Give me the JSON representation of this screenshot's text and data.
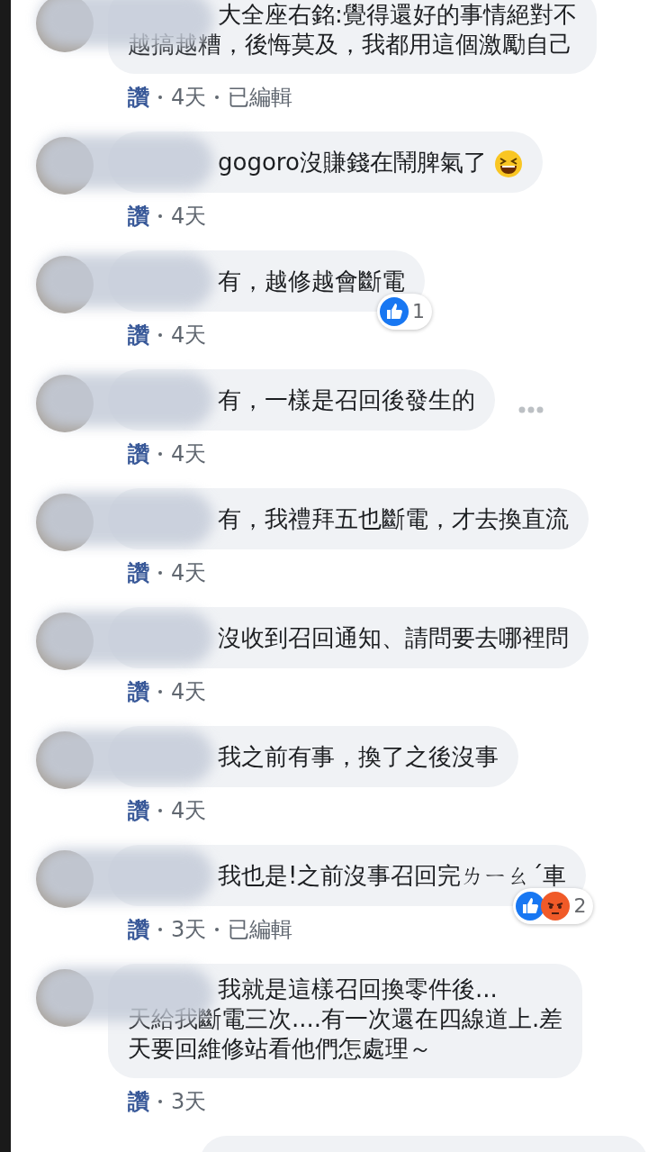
{
  "comments": [
    {
      "lines": [
        "大全座右銘:覺得還好的事情絕對不",
        "越搞越糟，後悔莫及，我都用這個激勵自己"
      ],
      "meta": {
        "like": "讚",
        "time": "4天",
        "edited": "已編輯"
      }
    },
    {
      "lines": [
        "gogoro沒賺錢在鬧脾氣了"
      ],
      "emoji": {
        "kind": "laughing"
      },
      "meta": {
        "like": "讚",
        "time": "4天"
      }
    },
    {
      "lines": [
        "有，越修越會斷電"
      ],
      "reactions": {
        "icons": [
          {
            "kind": "like"
          }
        ],
        "count": "1"
      },
      "meta": {
        "like": "讚",
        "time": "4天"
      }
    },
    {
      "lines": [
        "有，一樣是召回後發生的"
      ],
      "more_button": true,
      "meta": {
        "like": "讚",
        "time": "4天"
      }
    },
    {
      "lines": [
        "有，我禮拜五也斷電，才去換直流"
      ],
      "meta": {
        "like": "讚",
        "time": "4天"
      }
    },
    {
      "lines": [
        "沒收到召回通知、請問要去哪裡問"
      ],
      "meta": {
        "like": "讚",
        "time": "4天"
      }
    },
    {
      "lines": [
        "我之前有事，換了之後沒事"
      ],
      "meta": {
        "like": "讚",
        "time": "4天"
      }
    },
    {
      "lines": [
        "我也是!之前沒事召回完ㄌㄧㄠˊ車"
      ],
      "reactions": {
        "icons": [
          {
            "kind": "like"
          },
          {
            "kind": "angry"
          }
        ],
        "count": "2"
      },
      "meta": {
        "like": "讚",
        "time": "3天",
        "edited": "已編輯"
      }
    },
    {
      "lines": [
        "我就是這樣召回換零件後...",
        "天給我斷電三次....有一次還在四線道上.差",
        "天要回維修站看他們怎處理～"
      ],
      "meta": {
        "like": "讚",
        "time": "3天"
      }
    }
  ],
  "more_below": true
}
